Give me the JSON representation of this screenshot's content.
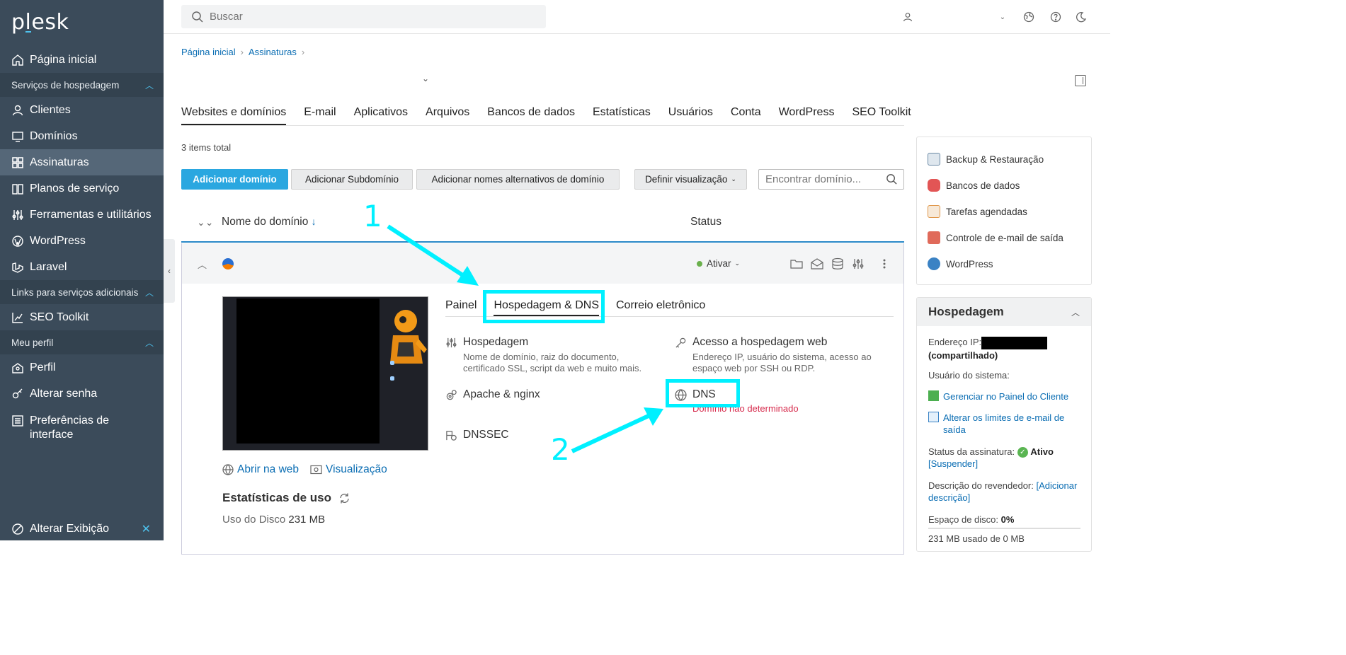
{
  "sidebar": {
    "logo": "plesk",
    "items": {
      "home": "Página inicial",
      "section_hosting": "Serviços de hospedagem",
      "clients": "Clientes",
      "domains": "Domínios",
      "subscriptions": "Assinaturas",
      "plans": "Planos de serviço",
      "tools": "Ferramentas e utilitários",
      "wordpress": "WordPress",
      "laravel": "Laravel",
      "section_links": "Links para serviços adicionais",
      "seo": "SEO Toolkit",
      "section_profile": "Meu perfil",
      "profile": "Perfil",
      "password": "Alterar senha",
      "preferences": "Preferências de interface"
    },
    "bottom": "Alterar Exibição"
  },
  "topbar": {
    "search_placeholder": "Buscar"
  },
  "breadcrumb": {
    "home": "Página inicial",
    "subscriptions": "Assinaturas"
  },
  "tabs": [
    "Websites e domínios",
    "E-mail",
    "Aplicativos",
    "Arquivos",
    "Bancos de dados",
    "Estatísticas",
    "Usuários",
    "Conta",
    "WordPress",
    "SEO Toolkit"
  ],
  "items_total": "3 items total",
  "toolbar": {
    "add_domain": "Adicionar domínio",
    "add_subdomain": "Adicionar Subdomínio",
    "add_alias": "Adicionar nomes alternativos de domínio",
    "view": "Definir visualização",
    "find_placeholder": "Encontrar domínio..."
  },
  "table": {
    "col_name": "Nome do domínio",
    "col_status": "Status"
  },
  "domain": {
    "status": "Ativar",
    "open_web": "Abrir na web",
    "preview": "Visualização",
    "stats_title": "Estatísticas de uso",
    "disk_label": "Uso do Disco",
    "disk_value": "231 MB",
    "inner_tabs": [
      "Painel",
      "Hospedagem & DNS",
      "Correio eletrônico"
    ],
    "tools": {
      "hosting_title": "Hospedagem",
      "hosting_desc": "Nome de domínio, raiz do documento, certificado SSL, script da web e muito mais.",
      "webaccess_title": "Acesso a hospedagem web",
      "webaccess_desc": "Endereço IP, usuário do sistema, acesso ao espaço web por SSH ou RDP.",
      "apache_title": "Apache & nginx",
      "dns_title": "DNS",
      "dns_warn": "Domínio não determinado",
      "dnssec_title": "DNSSEC"
    }
  },
  "annotations": {
    "one": "1",
    "two": "2",
    "color": "#00f0ff"
  },
  "side": {
    "backup": "Backup & Restauração",
    "databases": "Bancos de dados",
    "scheduled": "Tarefas agendadas",
    "mail_control": "Controle de e-mail de saída",
    "wordpress": "WordPress"
  },
  "hosting": {
    "title": "Hospedagem",
    "ip_label": "Endereço IP:",
    "ip_shared": "(compartilhado)",
    "sys_user": "Usuário do sistema:",
    "manage": "Gerenciar no Painel do Cliente",
    "mail_limits": "Alterar os limites de e-mail de saída",
    "sub_status_label": "Status da assinatura:",
    "sub_status": "Ativo",
    "suspend": "[Suspender]",
    "reseller_label": "Descrição do revendedor:",
    "add_desc": "[Adicionar descrição]",
    "disk_label": "Espaço de disco:",
    "disk_value": "0%",
    "disk_used": "231 MB usado de 0 MB"
  },
  "colors": {
    "sidebar": "#3b4b5a",
    "accent": "#2aa7e0",
    "link": "#0a6db3",
    "warn": "#d6294b"
  }
}
